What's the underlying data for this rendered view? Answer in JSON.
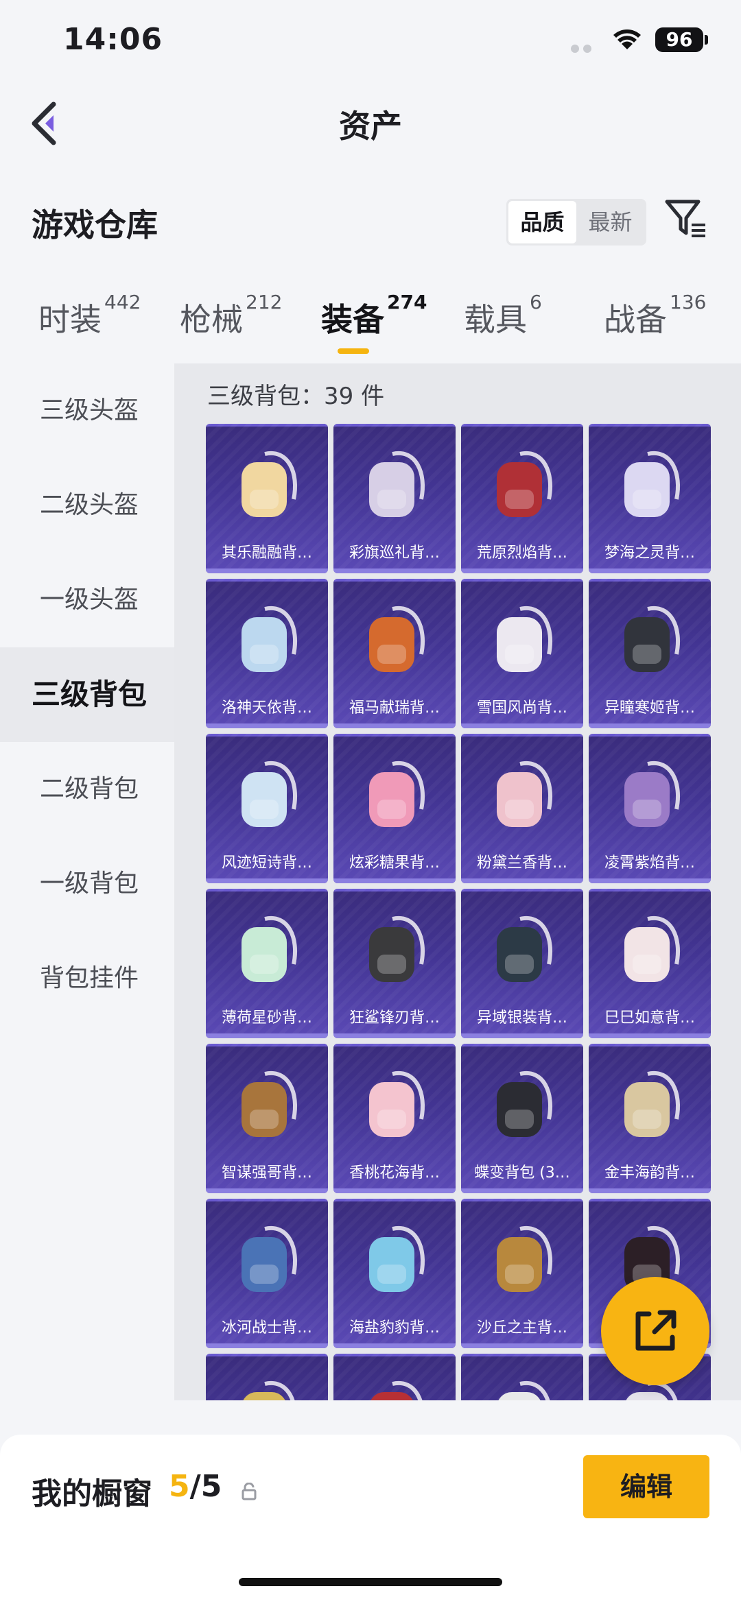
{
  "status_bar": {
    "time": "14:06",
    "battery": "96"
  },
  "nav": {
    "title": "资产"
  },
  "warehouse": {
    "title": "游戏仓库",
    "sort_options": [
      "品质",
      "最新"
    ],
    "sort_selected": "品质"
  },
  "tabs": [
    {
      "label": "时装",
      "count": "442"
    },
    {
      "label": "枪械",
      "count": "212"
    },
    {
      "label": "装备",
      "count": "274",
      "active": true
    },
    {
      "label": "载具",
      "count": "6"
    },
    {
      "label": "战备",
      "count": "136"
    }
  ],
  "sidebar": {
    "items": [
      "三级头盔",
      "二级头盔",
      "一级头盔",
      "三级背包",
      "二级背包",
      "一级背包",
      "背包挂件"
    ],
    "active": "三级背包"
  },
  "content": {
    "section_title": "三级背包：39 件",
    "items": [
      {
        "label": "其乐融融背…",
        "icon": "backpack-cream-bunny-icon",
        "color": "#f1d7a0"
      },
      {
        "label": "彩旗巡礼背…",
        "icon": "backpack-pastel-bunting-icon",
        "color": "#d7cfe6"
      },
      {
        "label": "荒原烈焰背…",
        "icon": "backpack-red-flame-icon",
        "color": "#b03036"
      },
      {
        "label": "梦海之灵背…",
        "icon": "backpack-coral-spirit-icon",
        "color": "#dcd8f2"
      },
      {
        "label": "洛神天依背…",
        "icon": "backpack-blue-fairy-icon",
        "color": "#bcd8ef"
      },
      {
        "label": "福马献瑞背…",
        "icon": "backpack-orange-horse-icon",
        "color": "#d56a2e"
      },
      {
        "label": "雪国风尚背…",
        "icon": "backpack-snow-penguin-icon",
        "color": "#ece8f0"
      },
      {
        "label": "异瞳寒姬背…",
        "icon": "backpack-black-cat-icon",
        "color": "#31343c"
      },
      {
        "label": "风迹短诗背…",
        "icon": "backpack-light-blue-ribbon-icon",
        "color": "#cfe3f3"
      },
      {
        "label": "炫彩糖果背…",
        "icon": "backpack-candy-donut-icon",
        "color": "#f09ab8"
      },
      {
        "label": "粉黛兰香背…",
        "icon": "backpack-pink-orchid-icon",
        "color": "#efc2cc"
      },
      {
        "label": "凌霄紫焰背…",
        "icon": "backpack-purple-flame-icon",
        "color": "#9b7bc7"
      },
      {
        "label": "薄荷星砂背…",
        "icon": "backpack-mint-star-icon",
        "color": "#c8ebd6"
      },
      {
        "label": "狂鲨锋刃背…",
        "icon": "backpack-shark-blade-icon",
        "color": "#3a3a3c"
      },
      {
        "label": "异域银装背…",
        "icon": "backpack-silver-tech-icon",
        "color": "#2c3a46"
      },
      {
        "label": "巳巳如意背…",
        "icon": "backpack-white-fox-icon",
        "color": "#f2e4e6"
      },
      {
        "label": "智谋强哥背…",
        "icon": "backpack-bear-icon",
        "color": "#a8753c"
      },
      {
        "label": "香桃花海背…",
        "icon": "backpack-peach-blossom-icon",
        "color": "#f4c4cf"
      },
      {
        "label": "蝶变背包 (3…",
        "icon": "backpack-butterfly-icon",
        "color": "#2b2c33"
      },
      {
        "label": "金丰海韵背…",
        "icon": "backpack-gold-sea-icon",
        "color": "#d9c7a0"
      },
      {
        "label": "冰河战士背…",
        "icon": "backpack-glacier-warrior-icon",
        "color": "#4a73b6"
      },
      {
        "label": "海盐豹豹背…",
        "icon": "backpack-sea-salt-leopard-icon",
        "color": "#7fc9e8"
      },
      {
        "label": "沙丘之主背…",
        "icon": "backpack-dune-lord-icon",
        "color": "#b8883d"
      },
      {
        "label": "",
        "icon": "backpack-red-black-icon",
        "color": "#2c1f26"
      },
      {
        "label": "",
        "icon": "backpack-gold-crown-icon",
        "color": "#d8b95a"
      },
      {
        "label": "",
        "icon": "backpack-red-leather-icon",
        "color": "#b73034"
      },
      {
        "label": "",
        "icon": "backpack-panda-icon",
        "color": "#e9e9ea"
      },
      {
        "label": "",
        "icon": "backpack-white-icon",
        "color": "#e4e2ea"
      }
    ]
  },
  "showcase": {
    "label": "我的橱窗",
    "count_current": "5",
    "count_total": "/5",
    "edit_label": "编辑"
  },
  "colors": {
    "accent": "#f8b412",
    "card_bg": "#433594"
  }
}
